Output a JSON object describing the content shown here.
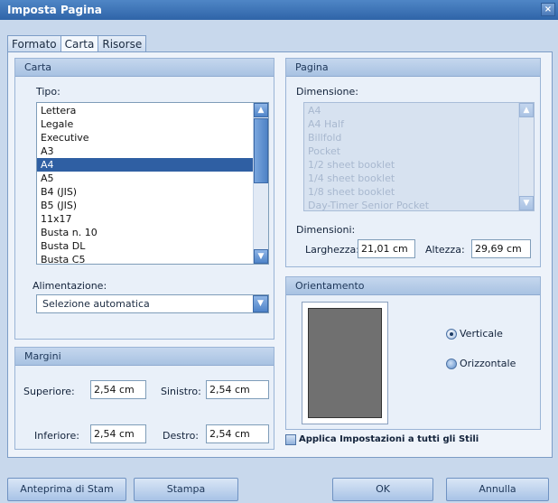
{
  "window": {
    "title": "Imposta Pagina",
    "close_glyph": "×"
  },
  "tabs": [
    {
      "label": "Formato"
    },
    {
      "label": "Carta"
    },
    {
      "label": "Risorse"
    }
  ],
  "carta": {
    "header": "Carta",
    "tipo_label": "Tipo:",
    "tipo_items": [
      "Lettera",
      "Legale",
      "Executive",
      "A3",
      "A4",
      "A5",
      "B4 (JIS)",
      "B5 (JIS)",
      "11x17",
      "Busta n. 10",
      "Busta DL",
      "Busta C5"
    ],
    "tipo_selected": "A4",
    "alimentazione_label": "Alimentazione:",
    "alimentazione_value": "Selezione automatica"
  },
  "margini": {
    "header": "Margini",
    "superiore_label": "Superiore:",
    "superiore_value": "2,54 cm",
    "sinistro_label": "Sinistro:",
    "sinistro_value": "2,54 cm",
    "inferiore_label": "Inferiore:",
    "inferiore_value": "2,54 cm",
    "destro_label": "Destro:",
    "destro_value": "2,54 cm"
  },
  "pagina": {
    "header": "Pagina",
    "dimensione_label": "Dimensione:",
    "dimensione_items": [
      "A4",
      "A4 Half",
      "Billfold",
      "Pocket",
      "1/2 sheet booklet",
      "1/4 sheet booklet",
      "1/8 sheet booklet",
      "Day-Timer Senior Pocket"
    ],
    "dimensioni_label": "Dimensioni:",
    "larghezza_label": "Larghezza:",
    "larghezza_value": "21,01 cm",
    "altezza_label": "Altezza:",
    "altezza_value": "29,69 cm"
  },
  "orientamento": {
    "header": "Orientamento",
    "verticale_label": "Verticale",
    "orizzontale_label": "Orizzontale",
    "selected": "Verticale"
  },
  "applica_label": "Applica Impostazioni a tutti gli Stili",
  "buttons": {
    "anteprima": "Anteprima di Stam",
    "stampa": "Stampa",
    "ok": "OK",
    "annulla": "Annulla"
  },
  "icons": {
    "scroll_up": "▲",
    "scroll_down": "▼",
    "dropdown": "▼"
  }
}
